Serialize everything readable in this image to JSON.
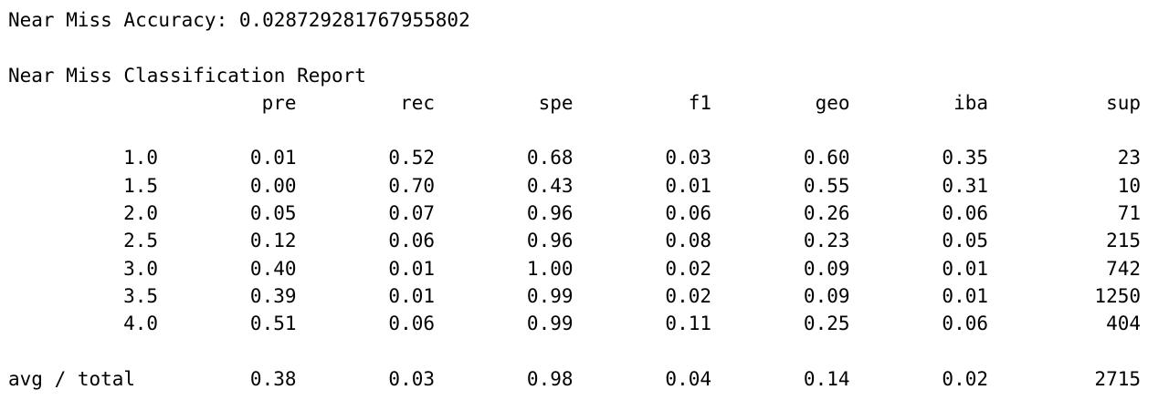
{
  "accuracy_line": "Near Miss Accuracy: 0.028729281767955802",
  "report_title": "Near Miss Classification Report",
  "headers": [
    "pre",
    "rec",
    "spe",
    "f1",
    "geo",
    "iba",
    "sup"
  ],
  "rows": [
    {
      "label": "1.0",
      "values": [
        "0.01",
        "0.52",
        "0.68",
        "0.03",
        "0.60",
        "0.35",
        "23"
      ]
    },
    {
      "label": "1.5",
      "values": [
        "0.00",
        "0.70",
        "0.43",
        "0.01",
        "0.55",
        "0.31",
        "10"
      ]
    },
    {
      "label": "2.0",
      "values": [
        "0.05",
        "0.07",
        "0.96",
        "0.06",
        "0.26",
        "0.06",
        "71"
      ]
    },
    {
      "label": "2.5",
      "values": [
        "0.12",
        "0.06",
        "0.96",
        "0.08",
        "0.23",
        "0.05",
        "215"
      ]
    },
    {
      "label": "3.0",
      "values": [
        "0.40",
        "0.01",
        "1.00",
        "0.02",
        "0.09",
        "0.01",
        "742"
      ]
    },
    {
      "label": "3.5",
      "values": [
        "0.39",
        "0.01",
        "0.99",
        "0.02",
        "0.09",
        "0.01",
        "1250"
      ]
    },
    {
      "label": "4.0",
      "values": [
        "0.51",
        "0.06",
        "0.99",
        "0.11",
        "0.25",
        "0.06",
        "404"
      ]
    }
  ],
  "total": {
    "label": "avg / total",
    "values": [
      "0.38",
      "0.03",
      "0.98",
      "0.04",
      "0.14",
      "0.02",
      "2715"
    ]
  }
}
